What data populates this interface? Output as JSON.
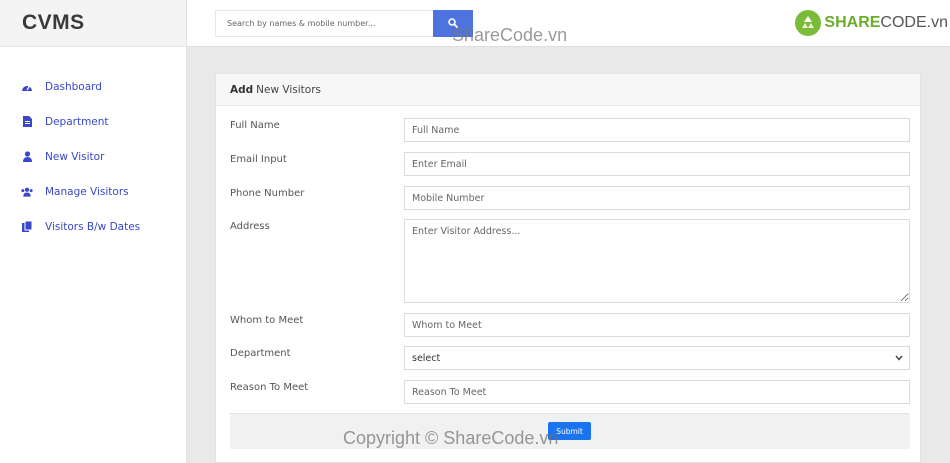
{
  "app": {
    "brand": "CVMS"
  },
  "sidebar": {
    "items": [
      {
        "label": "Dashboard",
        "icon": "dashboard-icon"
      },
      {
        "label": "Department",
        "icon": "file-icon"
      },
      {
        "label": "New Visitor",
        "icon": "user-icon"
      },
      {
        "label": "Manage Visitors",
        "icon": "users-icon"
      },
      {
        "label": "Visitors B/w Dates",
        "icon": "copy-icon"
      }
    ]
  },
  "search": {
    "placeholder": "Search by names & mobile number..."
  },
  "watermark": {
    "logo_part1": "SHARE",
    "logo_part2": "CODE.vn",
    "top": "ShareCode.vn",
    "bottom": "Copyright © ShareCode.vn"
  },
  "form": {
    "title_bold": "Add",
    "title_rest": "New Visitors",
    "fields": {
      "full_name": {
        "label": "Full Name",
        "placeholder": "Full Name"
      },
      "email": {
        "label": "Email Input",
        "placeholder": "Enter Email"
      },
      "phone": {
        "label": "Phone Number",
        "placeholder": "Mobile Number"
      },
      "address": {
        "label": "Address",
        "placeholder": "Enter Visitor Address..."
      },
      "whom": {
        "label": "Whom to Meet",
        "placeholder": "Whom to Meet"
      },
      "department": {
        "label": "Department",
        "value": "select"
      },
      "reason": {
        "label": "Reason To Meet",
        "placeholder": "Reason To Meet"
      }
    },
    "submit_label": "Submit"
  },
  "colors": {
    "accent": "#4e73df",
    "link": "#3848c8",
    "submit": "#1a74f0"
  }
}
